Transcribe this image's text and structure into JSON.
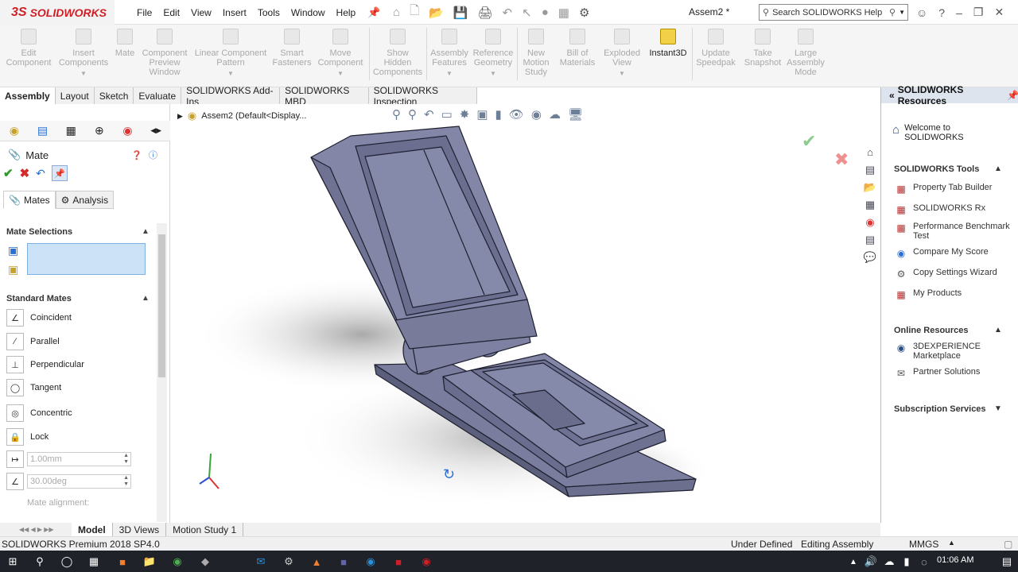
{
  "app": {
    "logo_ds": "3S",
    "logo_name": "SOLIDWORKS",
    "document_title": "Assem2 *"
  },
  "menu": [
    "File",
    "Edit",
    "View",
    "Insert",
    "Tools",
    "Window",
    "Help"
  ],
  "search": {
    "placeholder": "Search SOLIDWORKS Help"
  },
  "commands": [
    {
      "label": "Edit Component",
      "enabled": false
    },
    {
      "label": "Insert Components",
      "enabled": false
    },
    {
      "label": "Mate",
      "enabled": false
    },
    {
      "label": "Component Preview Window",
      "enabled": false
    },
    {
      "label": "Linear Component Pattern",
      "enabled": false
    },
    {
      "label": "Smart Fasteners",
      "enabled": false
    },
    {
      "label": "Move Component",
      "enabled": false
    },
    {
      "label": "Show Hidden Components",
      "enabled": false
    },
    {
      "label": "Assembly Features",
      "enabled": false
    },
    {
      "label": "Reference Geometry",
      "enabled": false
    },
    {
      "label": "New Motion Study",
      "enabled": false
    },
    {
      "label": "Bill of Materials",
      "enabled": false
    },
    {
      "label": "Exploded View",
      "enabled": false
    },
    {
      "label": "Instant3D",
      "enabled": true
    },
    {
      "label": "Update Speedpak",
      "enabled": false
    },
    {
      "label": "Take Snapshot",
      "enabled": false
    },
    {
      "label": "Large Assembly Mode",
      "enabled": false
    }
  ],
  "tabs": [
    "Assembly",
    "Layout",
    "Sketch",
    "Evaluate",
    "SOLIDWORKS Add-Ins",
    "SOLIDWORKS MBD",
    "SOLIDWORKS Inspection"
  ],
  "active_tab": "Assembly",
  "property_manager": {
    "title": "Mate",
    "subtabs": [
      "Mates",
      "Analysis"
    ],
    "mate_selections_title": "Mate Selections",
    "standard_mates_title": "Standard Mates",
    "mates": [
      "Coincident",
      "Parallel",
      "Perpendicular",
      "Tangent",
      "Concentric",
      "Lock"
    ],
    "distance_value": "1.00mm",
    "angle_value": "30.00deg",
    "mate_alignment_label": "Mate alignment:"
  },
  "graphics": {
    "tree_label": "Assem2  (Default<Display..."
  },
  "task_pane": {
    "title": "SOLIDWORKS Resources",
    "welcome": "Welcome to SOLIDWORKS",
    "tools_title": "SOLIDWORKS Tools",
    "tools": [
      "Property Tab Builder",
      "SOLIDWORKS Rx",
      "Performance Benchmark Test",
      "Compare My Score",
      "Copy Settings Wizard",
      "My Products"
    ],
    "online_title": "Online Resources",
    "online": [
      "3DEXPERIENCE Marketplace",
      "Partner Solutions"
    ],
    "subscription_title": "Subscription Services"
  },
  "bottom_tabs": [
    "Model",
    "3D Views",
    "Motion Study 1"
  ],
  "status": {
    "product": "SOLIDWORKS Premium 2018 SP4.0",
    "state": "Under Defined",
    "mode": "Editing Assembly",
    "units": "MMGS"
  },
  "clock": "01:06 AM",
  "colors": {
    "brand": "#cf1f26",
    "accent": "#2a6fd6",
    "model": "#7c7f9e"
  }
}
